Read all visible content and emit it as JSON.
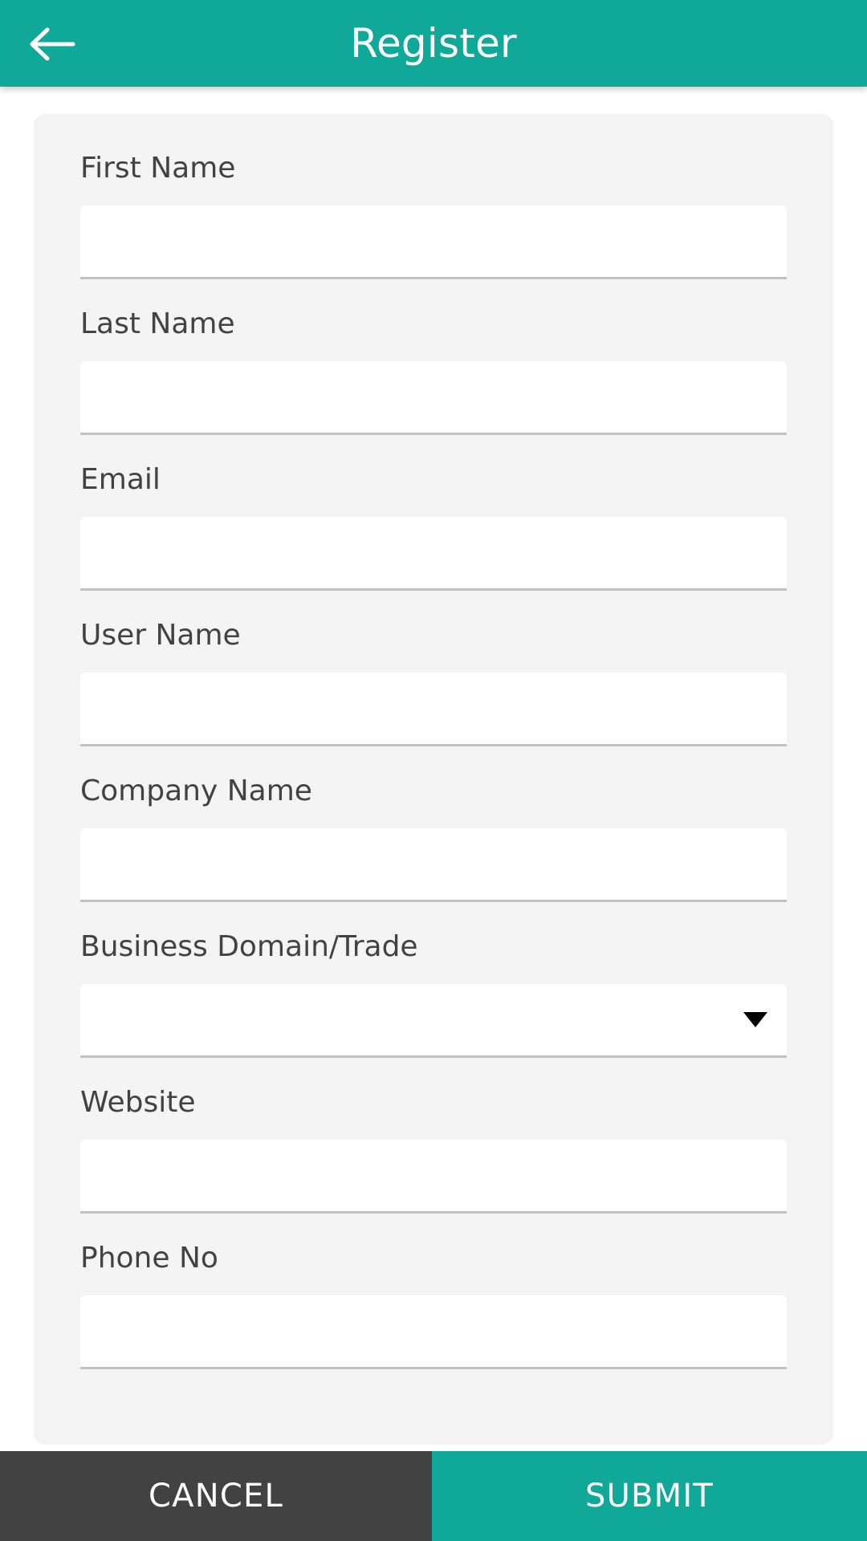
{
  "appbar": {
    "title": "Register",
    "back_icon": "arrow-left-icon",
    "background_color": "#10a898",
    "text_color": "#ffffff"
  },
  "form": {
    "card_background": "#f4f4f4",
    "label_color": "#424242",
    "underline_color": "#c2c2c2",
    "fields": [
      {
        "label": "First Name",
        "type": "text",
        "value": "",
        "placeholder": ""
      },
      {
        "label": "Last Name",
        "type": "text",
        "value": "",
        "placeholder": ""
      },
      {
        "label": "Email",
        "type": "email",
        "value": "",
        "placeholder": ""
      },
      {
        "label": "User Name",
        "type": "text",
        "value": "",
        "placeholder": ""
      },
      {
        "label": "Company Name",
        "type": "text",
        "value": "",
        "placeholder": ""
      },
      {
        "label": "Business Domain/Trade",
        "type": "select",
        "value": "",
        "placeholder": "",
        "caret_icon": "chevron-down-icon"
      },
      {
        "label": "Website",
        "type": "url",
        "value": "",
        "placeholder": ""
      },
      {
        "label": "Phone No",
        "type": "tel",
        "value": "",
        "placeholder": ""
      }
    ]
  },
  "action_bar": {
    "cancel_label": "CANCEL",
    "submit_label": "SUBMIT",
    "cancel_color": "#424242",
    "submit_color": "#10a898"
  }
}
